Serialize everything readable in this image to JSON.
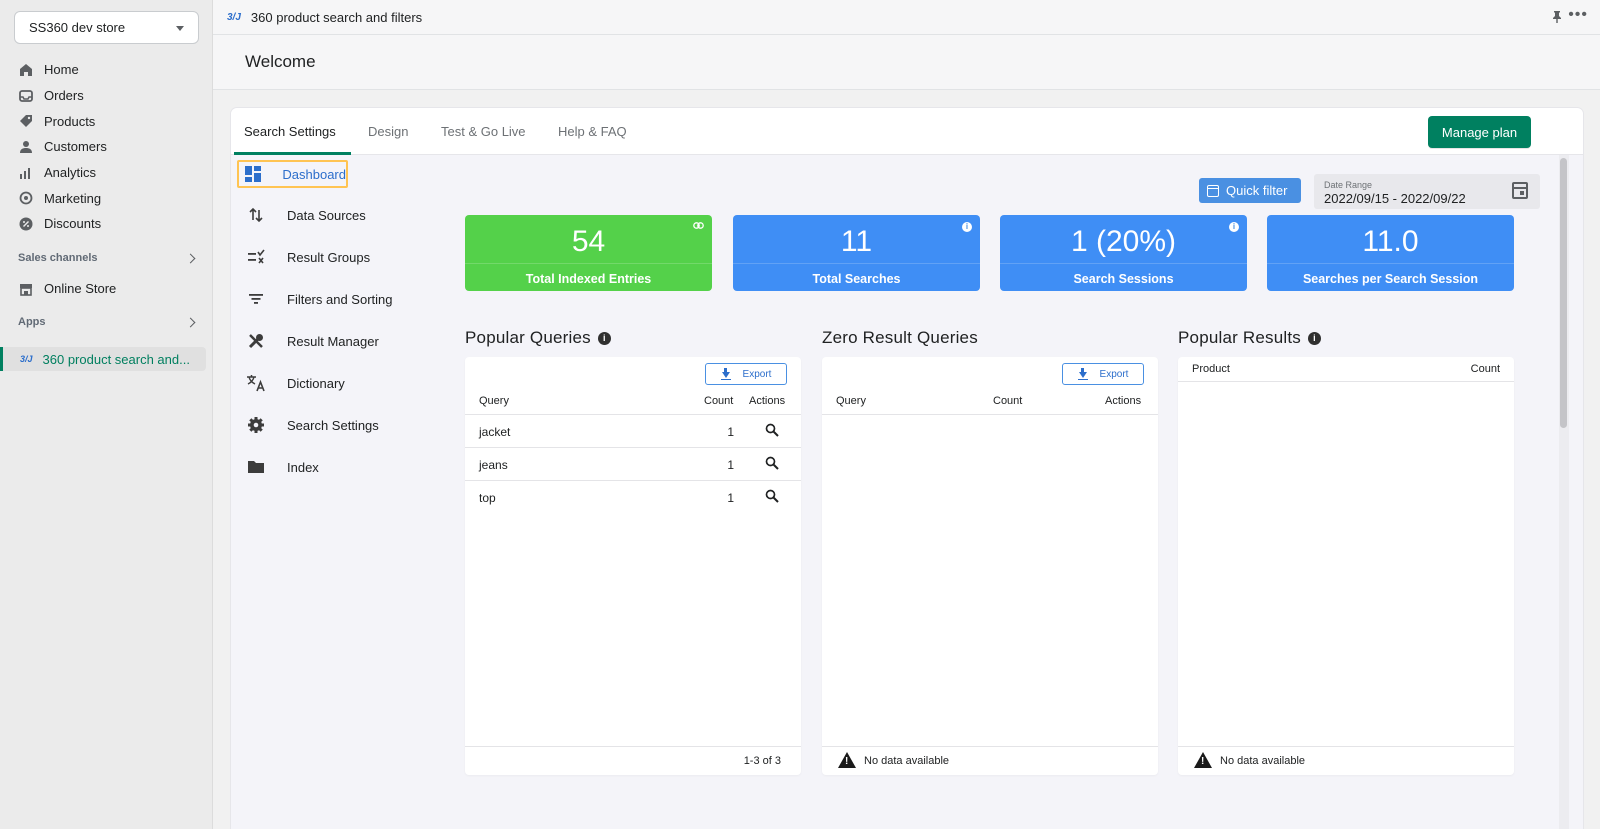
{
  "admin": {
    "store_name": "SS360 dev store",
    "nav": [
      {
        "label": "Home",
        "icon": "home-icon"
      },
      {
        "label": "Orders",
        "icon": "orders-icon"
      },
      {
        "label": "Products",
        "icon": "tag-icon"
      },
      {
        "label": "Customers",
        "icon": "person-icon"
      },
      {
        "label": "Analytics",
        "icon": "analytics-icon"
      },
      {
        "label": "Marketing",
        "icon": "marketing-icon"
      },
      {
        "label": "Discounts",
        "icon": "discount-icon"
      }
    ],
    "sales_channels_label": "Sales channels",
    "online_store_label": "Online Store",
    "apps_label": "Apps",
    "app_item_label": "360 product search and...",
    "app_logo": "3/J"
  },
  "topbar": {
    "app_logo": "3/J",
    "title": "360 product search and filters"
  },
  "page": {
    "title": "Welcome"
  },
  "tabs": [
    {
      "label": "Search Settings",
      "active": true
    },
    {
      "label": "Design",
      "active": false
    },
    {
      "label": "Test & Go Live",
      "active": false
    },
    {
      "label": "Help & FAQ",
      "active": false
    }
  ],
  "manage_plan_label": "Manage plan",
  "app_nav": [
    {
      "label": "Dashboard",
      "icon": "dashboard-icon",
      "active": true
    },
    {
      "label": "Data Sources",
      "icon": "data-sources-icon"
    },
    {
      "label": "Result Groups",
      "icon": "result-groups-icon"
    },
    {
      "label": "Filters and Sorting",
      "icon": "filter-icon"
    },
    {
      "label": "Result Manager",
      "icon": "tools-icon"
    },
    {
      "label": "Dictionary",
      "icon": "translate-icon"
    },
    {
      "label": "Search Settings",
      "icon": "gear-icon"
    },
    {
      "label": "Index",
      "icon": "folder-icon"
    }
  ],
  "filters": {
    "quick_filter_label": "Quick filter",
    "date_range_label": "Date Range",
    "date_range_value": "2022/09/15 - 2022/09/22"
  },
  "stats": [
    {
      "value": "54",
      "label": "Total Indexed Entries",
      "color": "#54d14a",
      "corner": "link-icon"
    },
    {
      "value": "11",
      "label": "Total Searches",
      "color": "#3f8ef5",
      "corner": "info-icon"
    },
    {
      "value": "1 (20%)",
      "label": "Search Sessions",
      "color": "#3f8ef5",
      "corner": "info-icon"
    },
    {
      "value": "11.0",
      "label": "Searches per Search Session",
      "color": "#3f8ef5",
      "corner": ""
    }
  ],
  "popular_queries": {
    "title": "Popular Queries",
    "export_label": "Export",
    "columns": [
      "Query",
      "Count",
      "Actions"
    ],
    "rows": [
      {
        "query": "jacket",
        "count": "1"
      },
      {
        "query": "jeans",
        "count": "1"
      },
      {
        "query": "top",
        "count": "1"
      }
    ],
    "pagination": "1-3 of 3"
  },
  "zero_result_queries": {
    "title": "Zero Result Queries",
    "export_label": "Export",
    "columns": [
      "Query",
      "Count",
      "Actions"
    ],
    "empty_text": "No data available"
  },
  "popular_results": {
    "title": "Popular Results",
    "columns": [
      "Product",
      "Count"
    ],
    "empty_text": "No data available"
  }
}
